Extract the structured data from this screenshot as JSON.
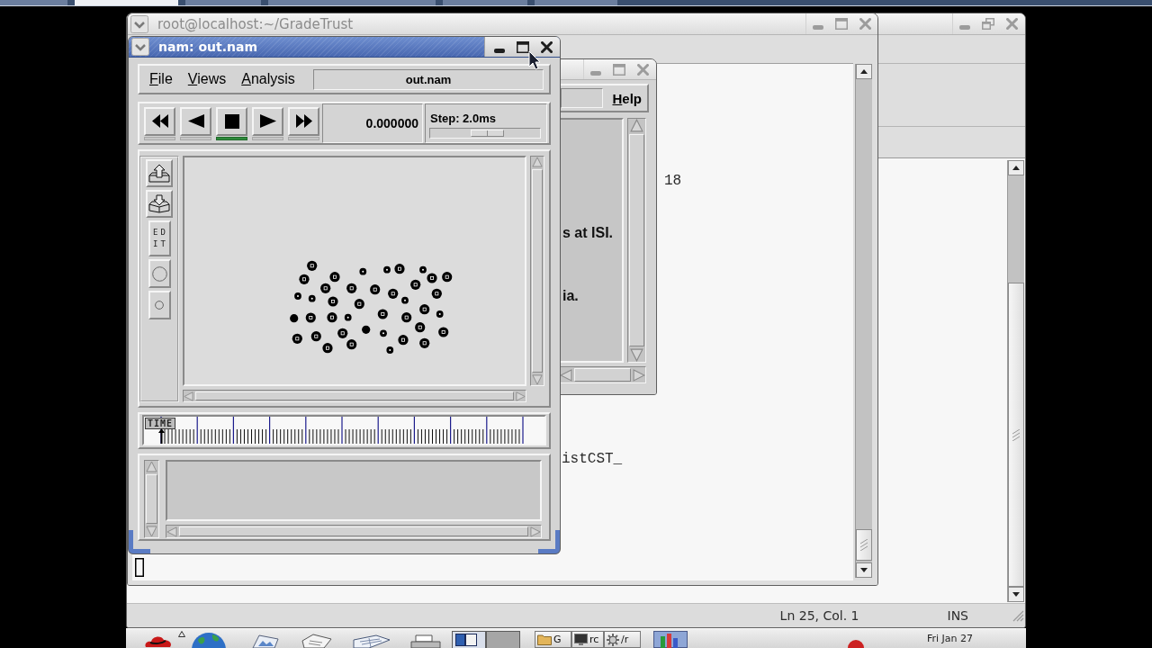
{
  "top_taskbar": {
    "buttons": [
      {
        "selected": false
      },
      {
        "selected": true
      },
      {
        "selected": false
      },
      {
        "selected": false
      },
      {
        "selected": false
      },
      {
        "selected": false
      }
    ]
  },
  "editor_window": {
    "status_bar": {
      "position": "Ln 25, Col. 1",
      "mode": "INS"
    }
  },
  "terminal_window": {
    "title": "root@localhost:~/GradeTrust",
    "lines": [
      "18",
      "istCST_"
    ]
  },
  "dialog_window": {
    "menu": "Help",
    "lines": [
      "s at ISI.",
      "ia."
    ]
  },
  "nam_window": {
    "title": "nam: out.nam",
    "menus": [
      "File",
      "Views",
      "Analysis"
    ],
    "file_name": "out.nam",
    "controls": [
      {
        "kind": "rewind",
        "selected": false
      },
      {
        "kind": "back",
        "selected": false
      },
      {
        "kind": "stop",
        "selected": true
      },
      {
        "kind": "play",
        "selected": false
      },
      {
        "kind": "fast_forward",
        "selected": false
      }
    ],
    "time": "0.000000",
    "step": {
      "label": "Step: 2.0ms",
      "level": 0.54
    },
    "tools": [
      {
        "kind": "zoom_in"
      },
      {
        "kind": "zoom_out"
      },
      {
        "kind": "edit",
        "label": "EDIT"
      },
      {
        "kind": "circle"
      },
      {
        "kind": "small_circle"
      }
    ],
    "timeline": {
      "label": "TIME",
      "level": 0
    }
  },
  "taskbar": {
    "workspaces": [
      {
        "selected": true
      },
      {
        "selected": false
      }
    ],
    "tasks": [
      {
        "kind": "folder",
        "label": "G"
      },
      {
        "kind": "terminal",
        "label": "rc"
      },
      {
        "kind": "gear",
        "label": "/r"
      }
    ],
    "clock": "Fri Jan 27"
  }
}
